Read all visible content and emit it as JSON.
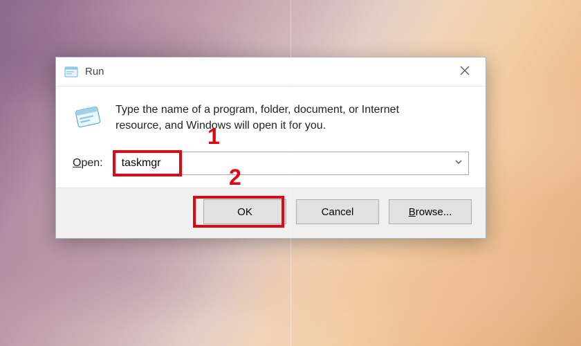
{
  "dialog": {
    "title": "Run",
    "description": "Type the name of a program, folder, document, or Internet resource, and Windows will open it for you.",
    "open_label_prefix": "O",
    "open_label_rest": "pen:",
    "input_value": "taskmgr",
    "buttons": {
      "ok": "OK",
      "cancel": "Cancel",
      "browse_prefix": "B",
      "browse_rest": "rowse..."
    }
  },
  "annotations": {
    "label1": "1",
    "label2": "2"
  }
}
